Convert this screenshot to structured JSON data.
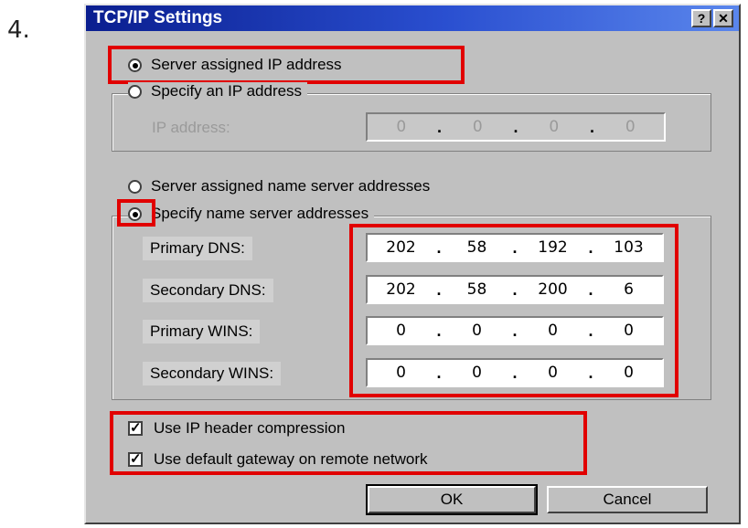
{
  "step_number": "4.",
  "window": {
    "title": "TCP/IP Settings",
    "help_button": "?",
    "close_button": "✕"
  },
  "ip_section": {
    "server_assigned_label": "Server assigned IP address",
    "specify_label": "Specify an IP address",
    "ip_address_label": "IP address:",
    "ip_address": [
      "0",
      "0",
      "0",
      "0"
    ]
  },
  "dns_section": {
    "server_assigned_label": "Server assigned name server addresses",
    "specify_label": "Specify name server addresses",
    "fields": [
      {
        "label": "Primary DNS:",
        "octets": [
          "202",
          "58",
          "192",
          "103"
        ]
      },
      {
        "label": "Secondary DNS:",
        "octets": [
          "202",
          "58",
          "200",
          "6"
        ]
      },
      {
        "label": "Primary WINS:",
        "octets": [
          "0",
          "0",
          "0",
          "0"
        ]
      },
      {
        "label": "Secondary WINS:",
        "octets": [
          "0",
          "0",
          "0",
          "0"
        ]
      }
    ]
  },
  "options": {
    "header_compression_label": "Use IP header compression",
    "default_gateway_label": "Use default gateway on remote network"
  },
  "buttons": {
    "ok": "OK",
    "cancel": "Cancel"
  },
  "colors": {
    "highlight": "#e10000",
    "titlebar_start": "#0a1e8f",
    "titlebar_end": "#5a86ec",
    "dialog_face": "#c0c0c0"
  }
}
